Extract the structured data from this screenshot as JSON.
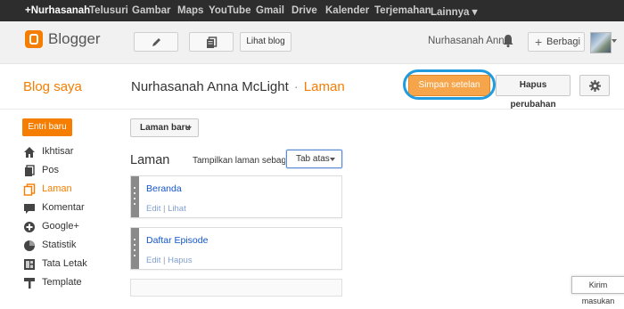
{
  "google_bar": {
    "items": [
      "+Nurhasanah",
      "Telusuri",
      "Gambar",
      "Maps",
      "YouTube",
      "Gmail",
      "Drive",
      "Kalender",
      "Terjemahan",
      "Lainnya ▾"
    ]
  },
  "header": {
    "logo_text": "Blogger",
    "view_blog_label": "Lihat blog",
    "user_name": "Nurhasanah Anna",
    "share_label": "Berbagi"
  },
  "titlebar": {
    "blog_saya": "Blog saya",
    "blog_name": "Nurhasanah Anna McLight",
    "separator": "·",
    "page_name": "Laman",
    "save_label": "Simpan setelan",
    "revert_label": "Hapus perubahan"
  },
  "sidebar": {
    "new_post_label": "Entri baru",
    "items": [
      {
        "label": "Ikhtisar",
        "icon": "home-icon"
      },
      {
        "label": "Pos",
        "icon": "posts-icon"
      },
      {
        "label": "Laman",
        "icon": "pages-icon",
        "active": true
      },
      {
        "label": "Komentar",
        "icon": "comment-icon"
      },
      {
        "label": "Google+",
        "icon": "google-plus-icon"
      },
      {
        "label": "Statistik",
        "icon": "stats-icon"
      },
      {
        "label": "Tata Letak",
        "icon": "layout-icon"
      },
      {
        "label": "Template",
        "icon": "template-icon"
      }
    ]
  },
  "main": {
    "new_page_label": "Laman baru",
    "section_title": "Laman",
    "display_label": "Tampilkan laman sebagai",
    "display_value": "Tab atas",
    "pages": [
      {
        "title": "Beranda",
        "link1": "Edit",
        "sep": "|",
        "link2": "Lihat"
      },
      {
        "title": "Daftar Episode",
        "link1": "Edit",
        "sep": "|",
        "link2": "Hapus"
      }
    ]
  },
  "feedback_label": "Kirim masukan",
  "colors": {
    "accent": "#f57d00",
    "link": "#1155cc",
    "highlight_ring": "#1f9bde"
  }
}
